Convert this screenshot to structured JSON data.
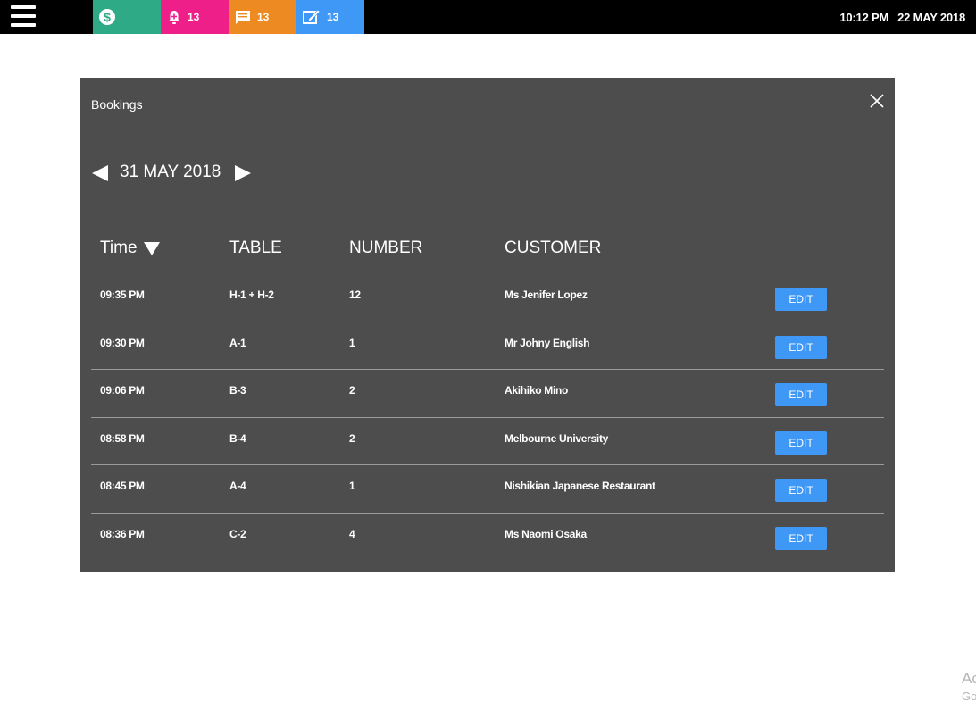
{
  "topbar": {
    "tiles": [
      {
        "icon": "dollar-icon",
        "count": "",
        "color": "#2faa86"
      },
      {
        "icon": "alert-icon",
        "count": "13",
        "color": "#ef1f8a"
      },
      {
        "icon": "message-icon",
        "count": "13",
        "color": "#ee8a22"
      },
      {
        "icon": "edit-note-icon",
        "count": "13",
        "color": "#3f97f6"
      }
    ],
    "time": "10:12 PM",
    "date": "22 MAY 2018"
  },
  "modal": {
    "title": "Bookings",
    "current_date": "31 MAY 2018",
    "columns": {
      "time": "Time",
      "table": "TABLE",
      "number": "NUMBER",
      "customer": "CUSTOMER"
    },
    "edit_label": "EDIT",
    "bookings": [
      {
        "time": "09:35 PM",
        "table": "H-1 + H-2",
        "number": "12",
        "customer": "Ms Jenifer Lopez"
      },
      {
        "time": "09:30 PM",
        "table": "A-1",
        "number": "1",
        "customer": "Mr Johny English"
      },
      {
        "time": "09:06 PM",
        "table": "B-3",
        "number": "2",
        "customer": "Akihiko Mino"
      },
      {
        "time": "08:58 PM",
        "table": "B-4",
        "number": "2",
        "customer": "Melbourne University"
      },
      {
        "time": "08:45 PM",
        "table": "A-4",
        "number": "1",
        "customer": "Nishikian Japanese Restaurant"
      },
      {
        "time": "08:36 PM",
        "table": "C-2",
        "number": "4",
        "customer": "Ms Naomi Osaka"
      }
    ]
  },
  "watermark": {
    "line1": "Ac",
    "line2": "Go"
  },
  "colors": {
    "modal_bg": "#4d4d4d",
    "accent": "#3f97f6"
  }
}
